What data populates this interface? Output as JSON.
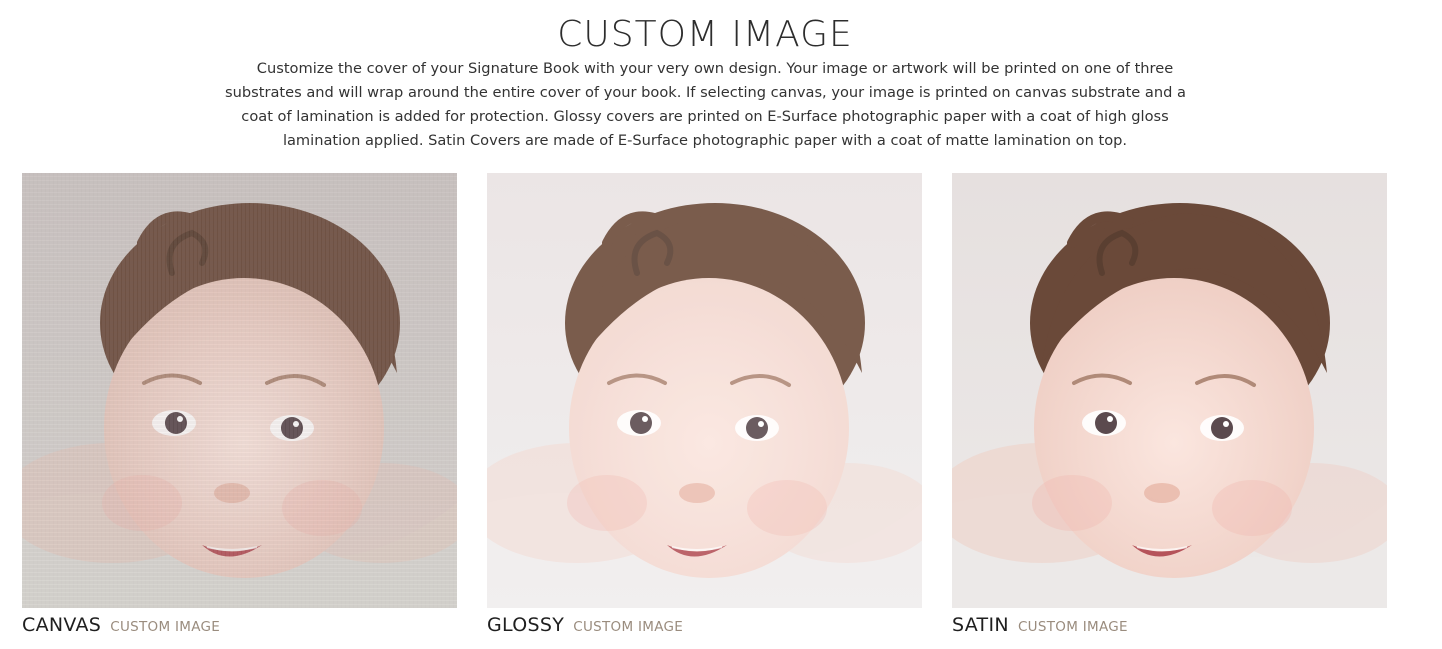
{
  "header": {
    "title": "CUSTOM IMAGE"
  },
  "description": {
    "lines": [
      "Customize the cover of your  Signature Book  with your very own design. Your image or artwork will be printed on one of three",
      "substrates and will wrap around the entire cover of your book. If selecting canvas, your image is printed on canvas substrate and a",
      "coat of lamination is added for protection. Glossy covers are printed on E-Surface photographic paper with a coat of high gloss",
      "lamination applied. Satin Covers are made of E-Surface photographic paper with a coat of matte lamination on top."
    ]
  },
  "options": [
    {
      "name": "CANVAS",
      "subtitle": "CUSTOM IMAGE",
      "image": "baby-portrait-canvas-texture",
      "tone": {
        "bg": "#cfc8c6",
        "skin": "#e8c8bd",
        "hair": "#6e4f3f",
        "blanket": "#dcdad6"
      }
    },
    {
      "name": "GLOSSY",
      "subtitle": "CUSTOM IMAGE",
      "image": "baby-portrait-glossy",
      "tone": {
        "bg": "#e9e3e3",
        "skin": "#f2d7cf",
        "hair": "#6b4a38",
        "blanket": "#f0eded"
      }
    },
    {
      "name": "SATIN",
      "subtitle": "CUSTOM IMAGE",
      "image": "baby-portrait-satin",
      "tone": {
        "bg": "#e6e0df",
        "skin": "#efcfc5",
        "hair": "#6a4939",
        "blanket": "#ece9e8"
      }
    }
  ],
  "colors": {
    "subtitle": "#9a8c7e",
    "text": "#333333"
  }
}
